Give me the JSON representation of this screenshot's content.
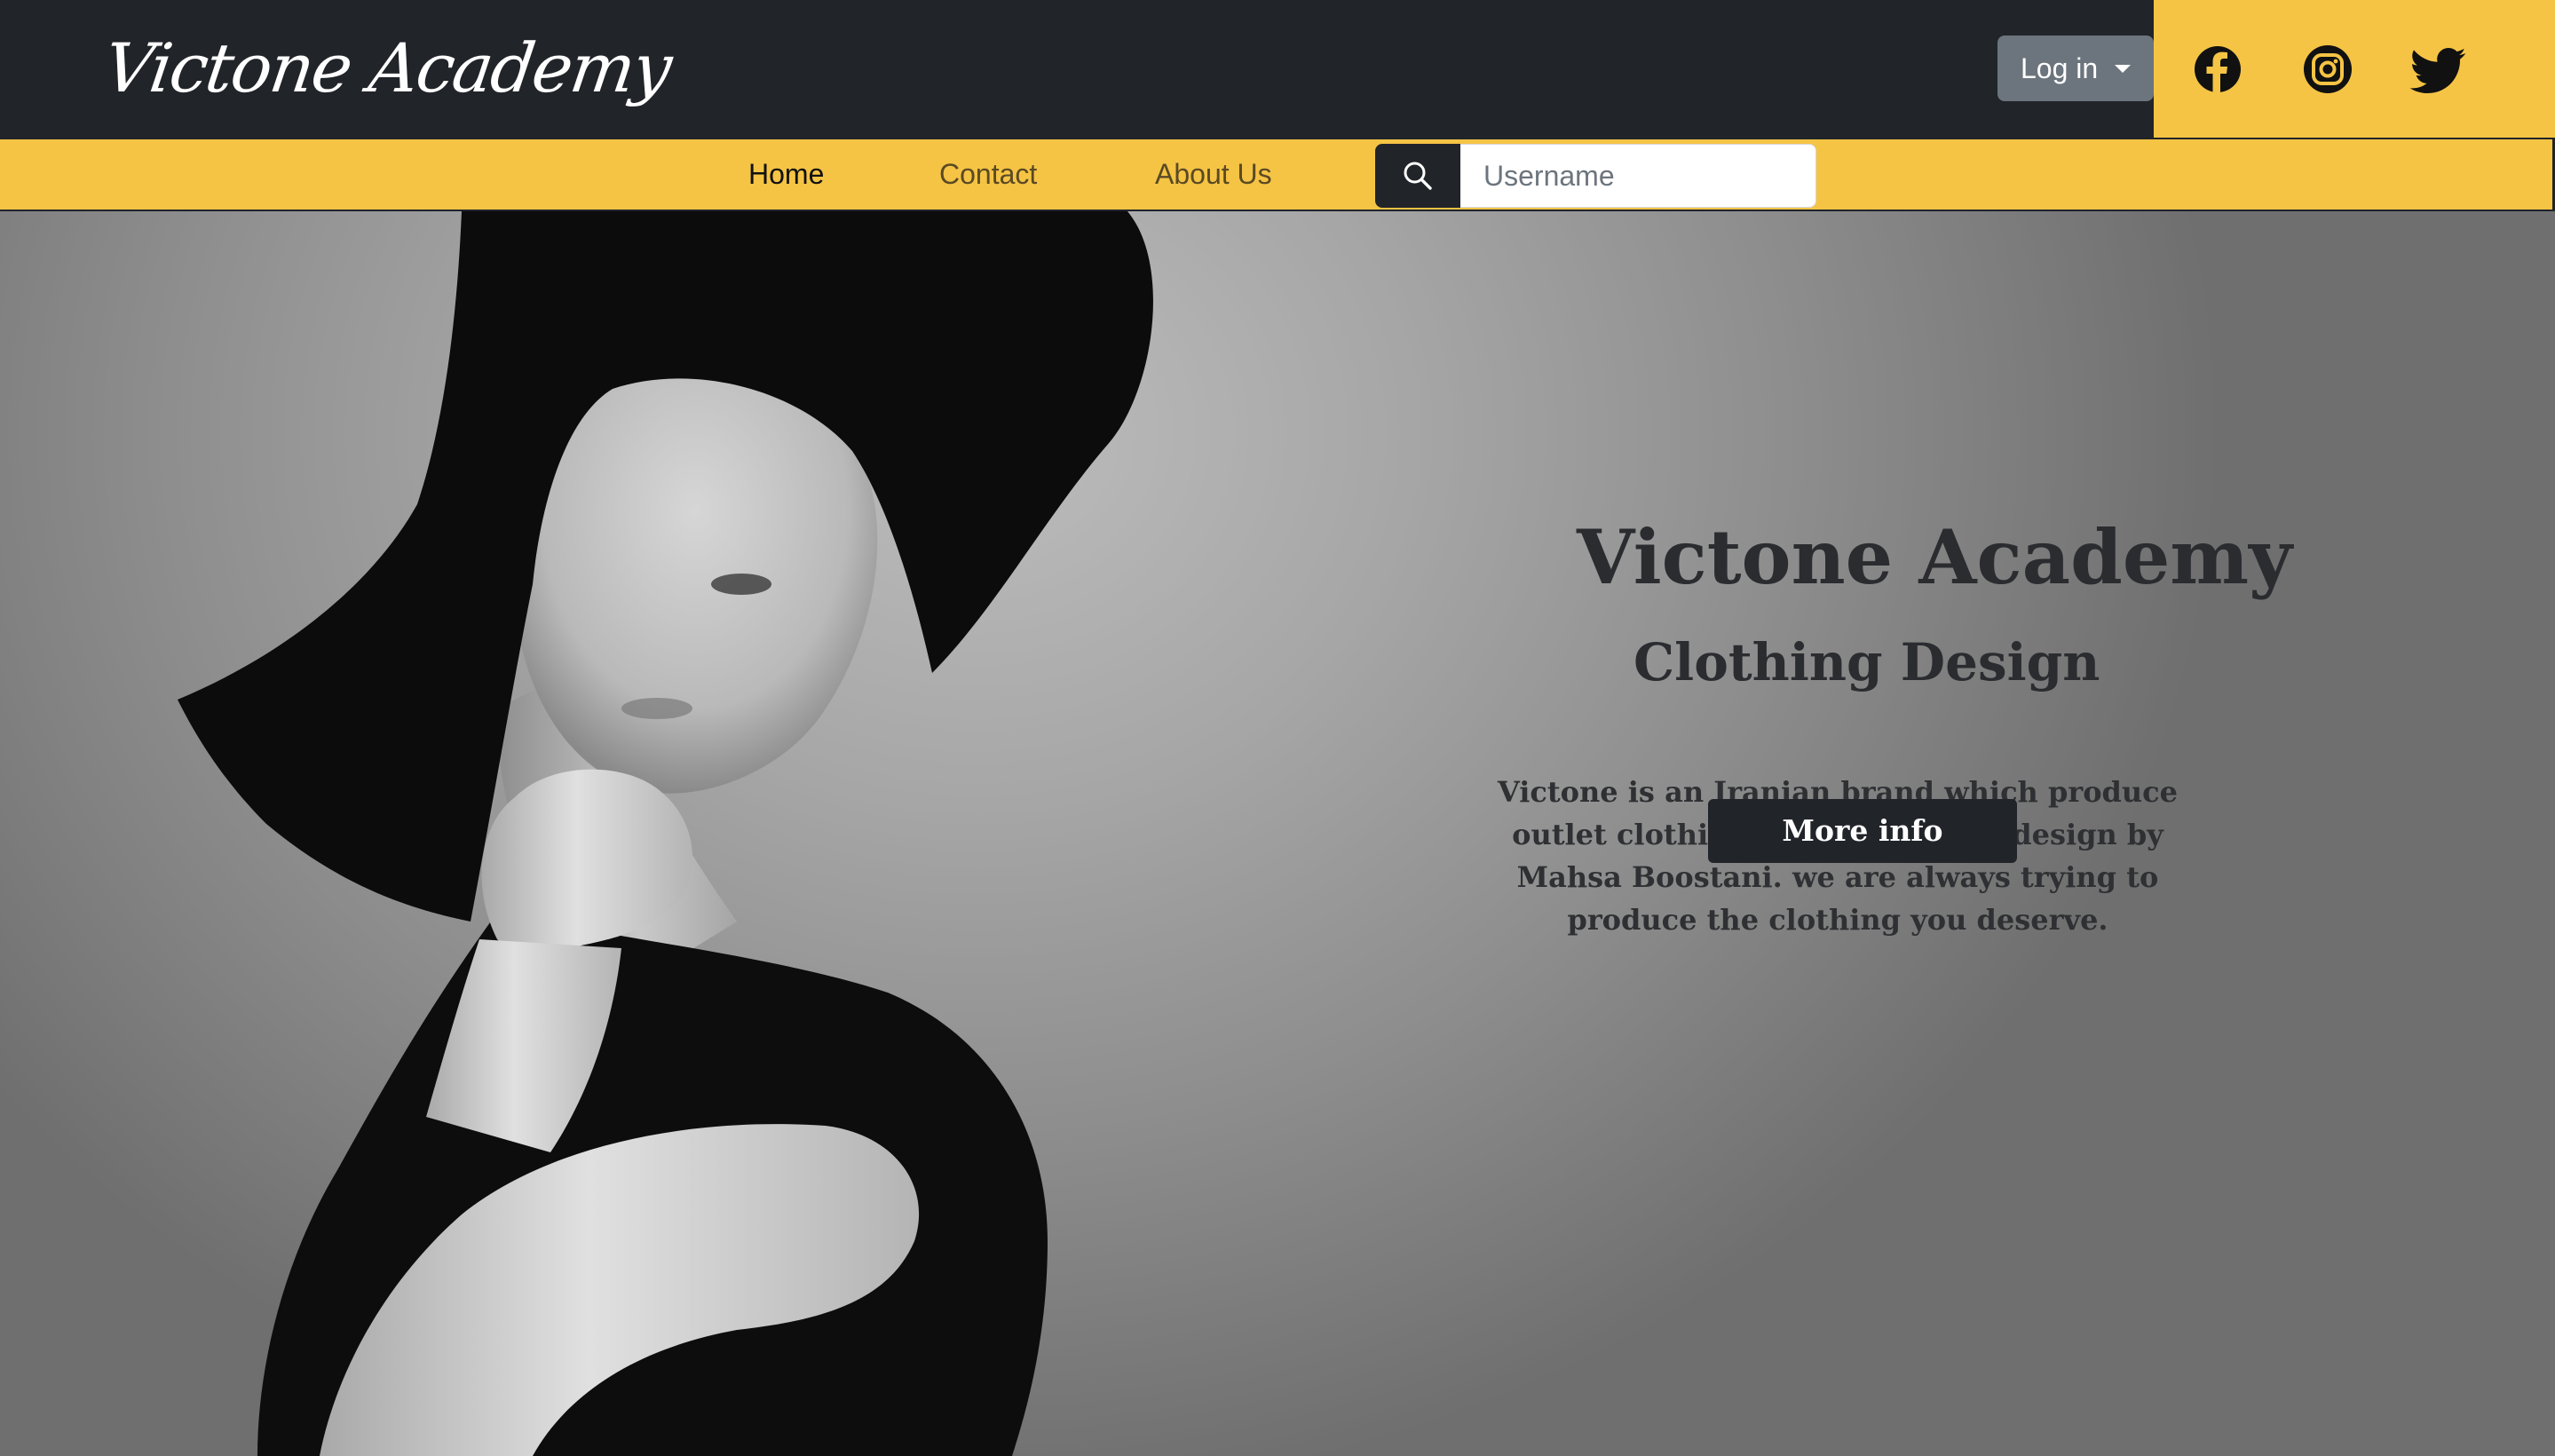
{
  "header": {
    "brand": "Victone Academy",
    "login_label": "Log in",
    "social": [
      {
        "icon": "facebook-icon"
      },
      {
        "icon": "instagram-icon"
      },
      {
        "icon": "twitter-icon"
      }
    ]
  },
  "nav": {
    "items": [
      {
        "label": "Home",
        "active": true
      },
      {
        "label": "Contact",
        "active": false
      },
      {
        "label": "About Us",
        "active": false
      }
    ],
    "search_placeholder": "Username",
    "search_icon": "search-icon"
  },
  "hero": {
    "title": "Victone Academy",
    "subtitle": "Clothing Design",
    "description": "Victone is an Iranian brand which produce outlet clothing for women that design by Mahsa Boostani. we are always trying to produce the clothing you deserve.",
    "button_label": "More info"
  },
  "colors": {
    "header_bg": "#212429",
    "accent_yellow": "#f5c445",
    "login_button": "#6c757d",
    "hero_text": "#2b2c30"
  }
}
